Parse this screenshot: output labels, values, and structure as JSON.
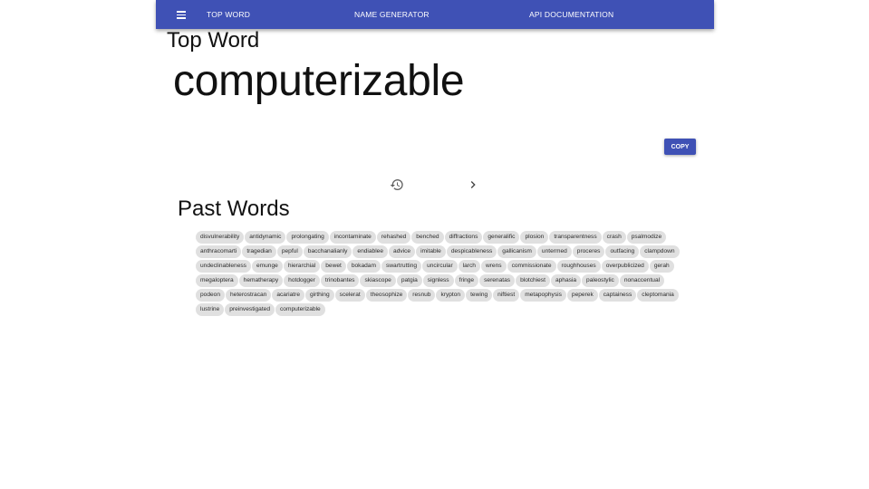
{
  "nav": {
    "menu_icon": "menu-icon",
    "links": [
      "TOP WORD",
      "NAME GENERATOR",
      "API DOCUMENTATION"
    ]
  },
  "main": {
    "heading": "Top Word",
    "top_word": "computerizable",
    "copy_label": "COPY",
    "history_icon": "history-icon",
    "next_icon": "chevron-right-icon",
    "past_heading": "Past Words"
  },
  "past_words": [
    [
      "disvulnerability",
      "antidynamic",
      "prolongating",
      "incontaminate",
      "rehashed",
      "benched",
      "diffractions",
      "generalific",
      "plosion",
      "transparentness",
      "crash",
      "psalmodize"
    ],
    [
      "anthracomarti",
      "tragedian",
      "pepful",
      "bacchanalianly",
      "endiablee",
      "advice",
      "imitable",
      "despicableness",
      "gallicanism",
      "untermed",
      "proceres",
      "outfacing",
      "clampdown"
    ],
    [
      "undeclinableness",
      "emunge",
      "hierarchial",
      "bewet",
      "bokadam",
      "swartrutting",
      "uncircular",
      "larch",
      "wrens",
      "commissionate",
      "roughhouses",
      "overpublicized",
      "gerah"
    ],
    [
      "megaloptera",
      "hematherapy",
      "hotdogger",
      "trinobantes",
      "skiascope",
      "patgia",
      "signless",
      "fringe",
      "serenatas",
      "blotchiest",
      "aphasia",
      "paleostylic",
      "nonaccentual"
    ],
    [
      "podeon",
      "heterostracan",
      "acariatre",
      "girthing",
      "scelerat",
      "theosophize",
      "resnub",
      "krypton",
      "tewing",
      "niftiest",
      "metapophysis",
      "peperek",
      "captainess",
      "cleptomania"
    ],
    [
      "lustrine",
      "preinvestigated",
      "computerizable"
    ]
  ],
  "colors": {
    "primary": "#3f51b5",
    "chip": "#e0e0e0"
  }
}
